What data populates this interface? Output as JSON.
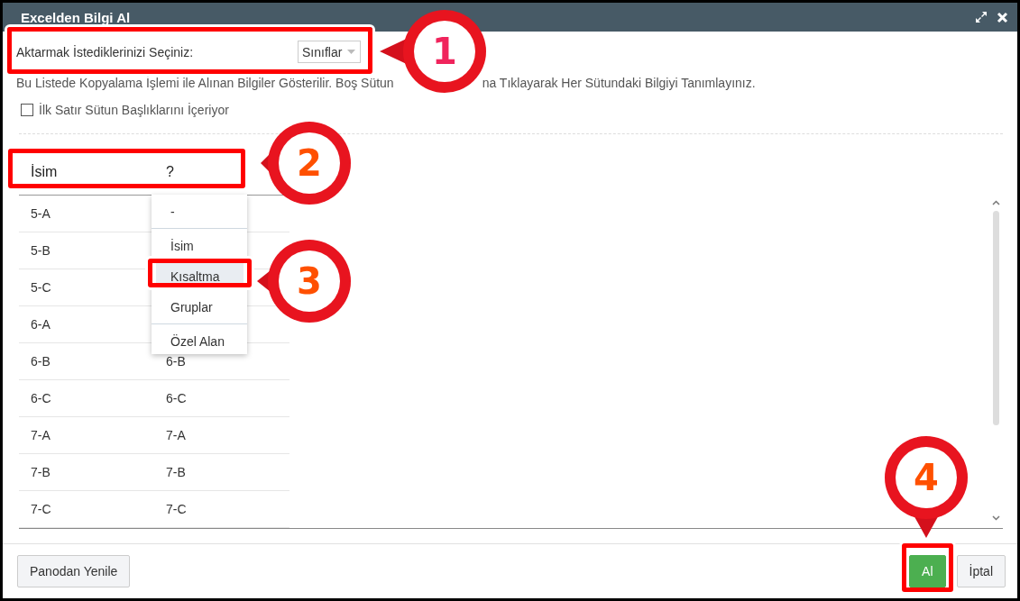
{
  "window": {
    "title": "Excelden Bilgi Al"
  },
  "source": {
    "label": "Aktarmak İstediklerinizi Seçiniz:",
    "value": "Sınıflar"
  },
  "description": [
    "Bu Listede Kopyalama İşlemi ile Alınan Bilgiler Gösterilir. Boş Sütun",
    "na Tıklayarak Her Sütundaki Bilgiyi Tanımlayınız."
  ],
  "header_checkbox": {
    "label": "İlk Satır Sütun Başlıklarını İçeriyor",
    "checked": false
  },
  "table": {
    "columns": [
      "İsim",
      "?"
    ],
    "rows": [
      [
        "5-A"
      ],
      [
        "5-B"
      ],
      [
        "5-C"
      ],
      [
        "6-A"
      ],
      [
        "6-B",
        "6-B"
      ],
      [
        "6-C",
        "6-C"
      ],
      [
        "7-A",
        "7-A"
      ],
      [
        "7-B",
        "7-B"
      ],
      [
        "7-C",
        "7-C"
      ]
    ]
  },
  "column_menu": {
    "items": [
      {
        "label": "-",
        "selected": false,
        "divider_after": true
      },
      {
        "label": "İsim",
        "selected": false,
        "divider_after": false
      },
      {
        "label": "Kısaltma",
        "selected": true,
        "divider_after": false
      },
      {
        "label": "Gruplar",
        "selected": false,
        "divider_after": true
      },
      {
        "label": "Özel Alan",
        "selected": false,
        "divider_after": false
      }
    ]
  },
  "callouts": [
    {
      "number": "1",
      "color": "#f0245c"
    },
    {
      "number": "2",
      "color": "#ff5000"
    },
    {
      "number": "3",
      "color": "#ff5000"
    },
    {
      "number": "4",
      "color": "#ff5000"
    }
  ],
  "buttons": [
    {
      "label": "Panodan Yenile",
      "kind": "default"
    },
    {
      "label": "Al",
      "kind": "primary"
    },
    {
      "label": "İptal",
      "kind": "default"
    }
  ]
}
